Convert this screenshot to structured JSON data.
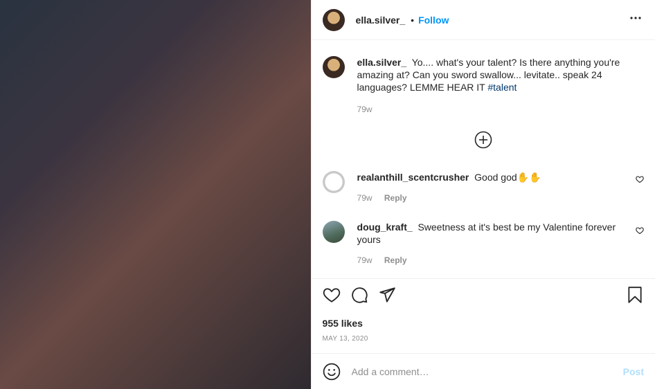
{
  "header": {
    "username": "ella.silver_",
    "dot": "•",
    "follow": "Follow",
    "more": "•••"
  },
  "caption": {
    "username": "ella.silver_",
    "text": "Yo.... what's your talent? Is there anything you're amazing at? Can you sword swallow... levitate.. speak 24 languages? LEMME HEAR IT",
    "hashtag": "#talent",
    "time": "79w"
  },
  "comments": [
    {
      "username": "realanthill_scentcrusher",
      "text": "Good god✋✋",
      "time": "79w",
      "reply": "Reply"
    },
    {
      "username": "doug_kraft_",
      "text": "Sweetness at it's best be my Valentine forever yours",
      "time": "79w",
      "reply": "Reply"
    }
  ],
  "likes": "955 likes",
  "date": "MAY 13, 2020",
  "add_comment": {
    "placeholder": "Add a comment…",
    "post": "Post"
  },
  "icons": [
    "like-icon",
    "comment-icon",
    "share-icon",
    "save-icon",
    "emoji-icon",
    "load-more-icon",
    "more-icon"
  ],
  "colors": {
    "accent": "#0095f6",
    "hashtag": "#00376b",
    "muted": "#8e8e8e",
    "post_disabled": "#b2dffc"
  }
}
